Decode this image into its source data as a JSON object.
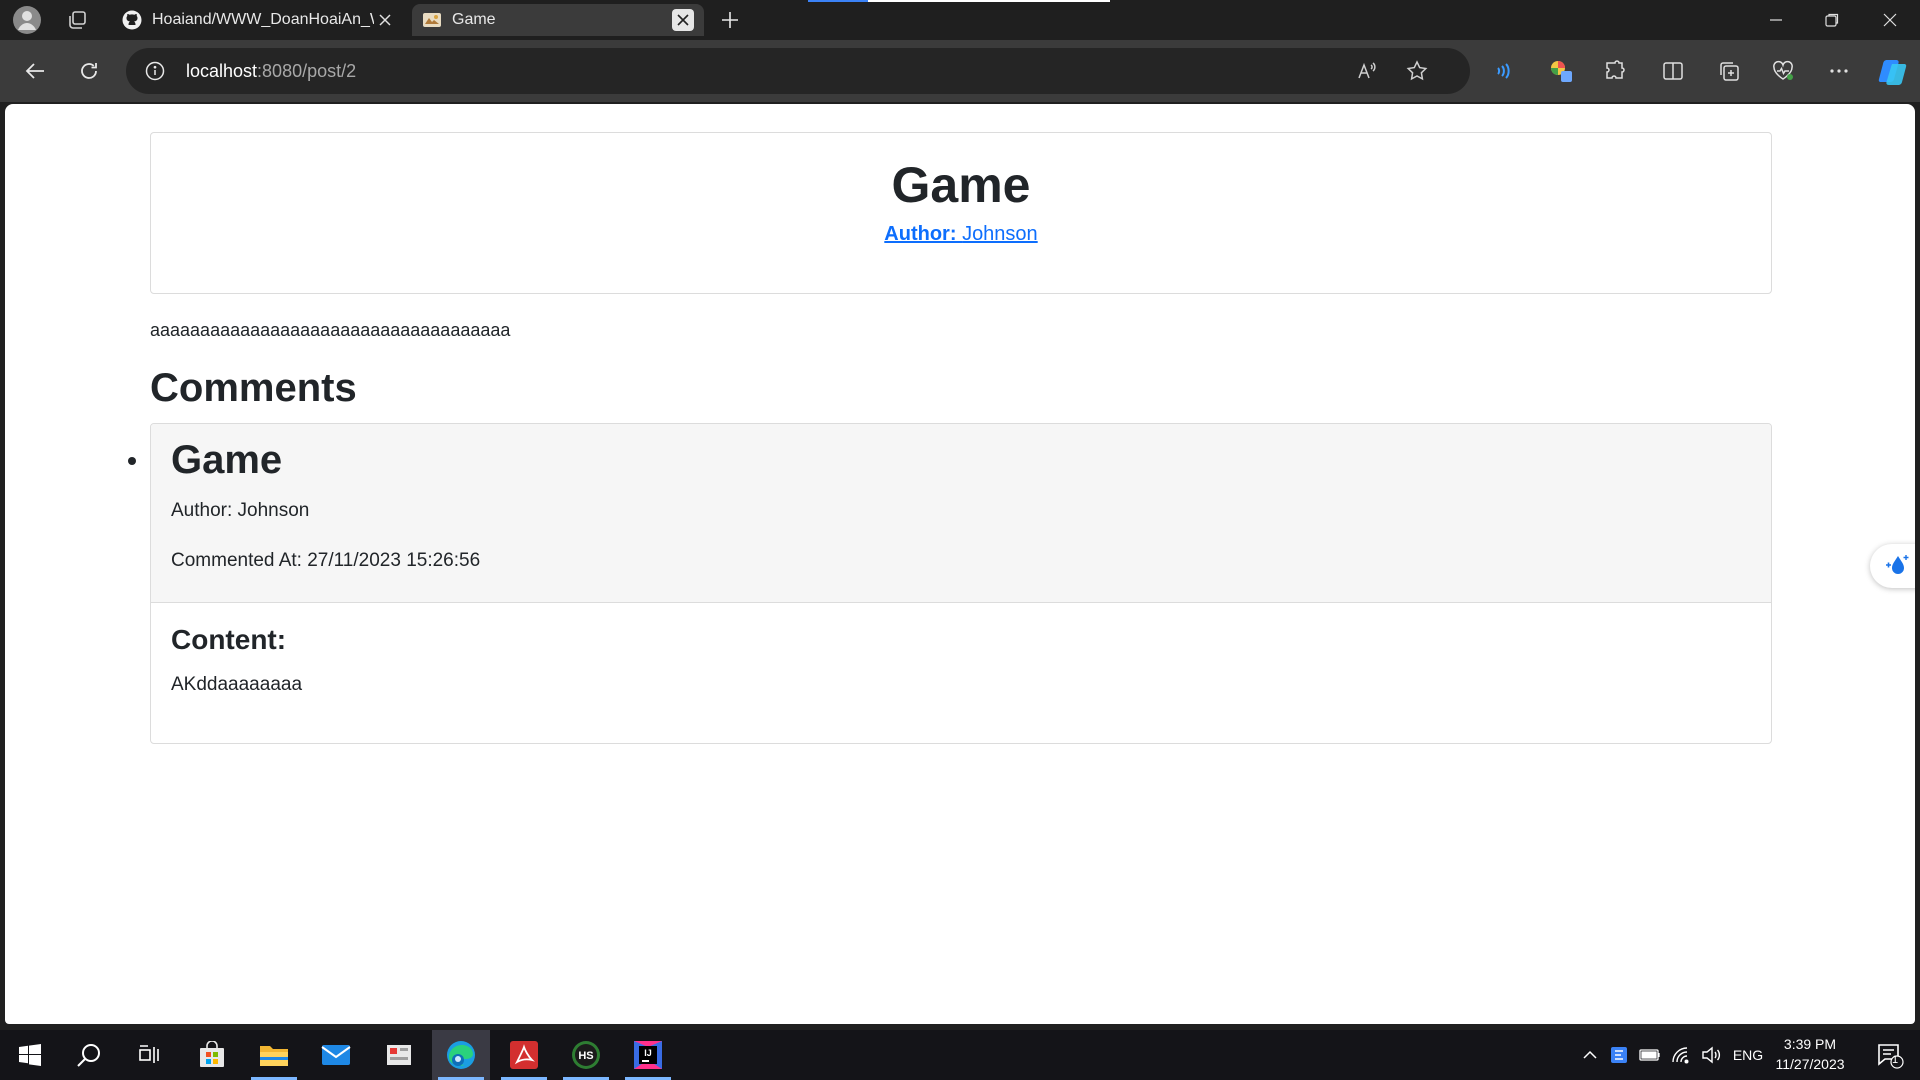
{
  "browser": {
    "tabs": [
      {
        "title": "Hoaiand/WWW_DoanHoaiAn_W",
        "favicon": "github-icon",
        "active": false
      },
      {
        "title": "Game",
        "favicon": "game-favicon",
        "active": true
      }
    ],
    "address": {
      "host": "localhost",
      "path": ":8080/post/2"
    },
    "accent": "#3b82f6"
  },
  "post": {
    "title": "Game",
    "author_label": "Author:",
    "author_name": "Johnson",
    "body": "aaaaaaaaaaaaaaaaaaaaaaaaaaaaaaaaaaaa",
    "link_color": "#0d6efd"
  },
  "comments": {
    "heading": "Comments",
    "items": [
      {
        "title": "Game",
        "author": "Author: Johnson",
        "commented_at": "Commented At: 27/11/2023 15:26:56",
        "content_label": "Content:",
        "content": "AKddaaaaaaaa"
      }
    ]
  },
  "taskbar": {
    "apps": [
      "windows-start-icon",
      "search-icon",
      "task-view-icon",
      "microsoft-store-icon",
      "file-explorer-icon",
      "mail-icon",
      "snipping-app-icon",
      "edge-icon",
      "acrobat-icon",
      "hs-app-icon",
      "intellij-icon"
    ],
    "language": "ENG",
    "time": "3:39 PM",
    "date": "11/27/2023",
    "notification_count": "1"
  }
}
